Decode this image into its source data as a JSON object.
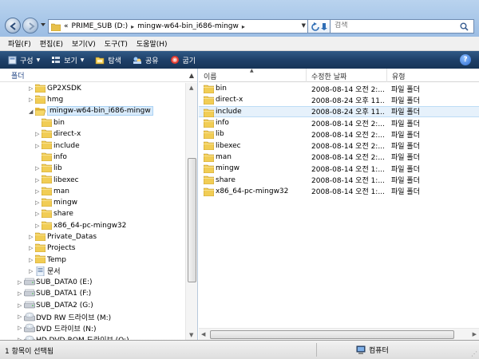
{
  "address": {
    "crumbs_prefix": "«",
    "crumbs": [
      "PRIME_SUB (D:)",
      "mingw-w64-bin_i686-mingw"
    ],
    "search_placeholder": "검색"
  },
  "menu": [
    "파일(F)",
    "편집(E)",
    "보기(V)",
    "도구(T)",
    "도움말(H)"
  ],
  "toolbar": {
    "organize": "구성",
    "views": "보기",
    "explore": "탐색",
    "share": "공유",
    "burn": "굽기",
    "help": "?"
  },
  "left_pane": {
    "header": "폴더",
    "tree": [
      {
        "label": "GP2XSDK",
        "level": 1,
        "type": "folder",
        "expanded": false
      },
      {
        "label": "hmg",
        "level": 1,
        "type": "folder",
        "expanded": false
      },
      {
        "label": "mingw-w64-bin_i686-mingw",
        "level": 1,
        "type": "folder",
        "expanded": true,
        "selected": true
      },
      {
        "label": "bin",
        "level": 2,
        "type": "folder",
        "expanded": null
      },
      {
        "label": "direct-x",
        "level": 2,
        "type": "folder",
        "expanded": false
      },
      {
        "label": "include",
        "level": 2,
        "type": "folder",
        "expanded": false
      },
      {
        "label": "info",
        "level": 2,
        "type": "folder",
        "expanded": null
      },
      {
        "label": "lib",
        "level": 2,
        "type": "folder",
        "expanded": false
      },
      {
        "label": "libexec",
        "level": 2,
        "type": "folder",
        "expanded": false
      },
      {
        "label": "man",
        "level": 2,
        "type": "folder",
        "expanded": false
      },
      {
        "label": "mingw",
        "level": 2,
        "type": "folder",
        "expanded": false
      },
      {
        "label": "share",
        "level": 2,
        "type": "folder",
        "expanded": false
      },
      {
        "label": "x86_64-pc-mingw32",
        "level": 2,
        "type": "folder",
        "expanded": false
      },
      {
        "label": "Private_Datas",
        "level": 1,
        "type": "folder",
        "expanded": false
      },
      {
        "label": "Projects",
        "level": 1,
        "type": "folder",
        "expanded": false
      },
      {
        "label": "Temp",
        "level": 1,
        "type": "folder",
        "expanded": false
      },
      {
        "label": "문서",
        "level": 1,
        "type": "doc",
        "expanded": false
      },
      {
        "label": "SUB_DATA0 (E:)",
        "level": 0,
        "type": "drive",
        "expanded": false
      },
      {
        "label": "SUB_DATA1 (F:)",
        "level": 0,
        "type": "drive",
        "expanded": false
      },
      {
        "label": "SUB_DATA2 (G:)",
        "level": 0,
        "type": "drive",
        "expanded": false
      },
      {
        "label": "DVD RW 드라이브 (M:)",
        "level": 0,
        "type": "dvd",
        "expanded": false
      },
      {
        "label": "DVD 드라이브 (N:)",
        "level": 0,
        "type": "dvd",
        "expanded": false
      },
      {
        "label": "HD DVD-ROM 드라이브 (O:)",
        "level": 0,
        "type": "dvd",
        "expanded": false
      }
    ]
  },
  "columns": {
    "name": "이름",
    "date": "수정한 날짜",
    "type": "유형"
  },
  "files": [
    {
      "name": "bin",
      "date": "2008-08-14 오전 2:...",
      "type": "파일 폴더"
    },
    {
      "name": "direct-x",
      "date": "2008-08-24 오후 11...",
      "type": "파일 폴더"
    },
    {
      "name": "include",
      "date": "2008-08-24 오후 11...",
      "type": "파일 폴더",
      "selected": true
    },
    {
      "name": "info",
      "date": "2008-08-14 오전 2:...",
      "type": "파일 폴더"
    },
    {
      "name": "lib",
      "date": "2008-08-14 오전 2:...",
      "type": "파일 폴더"
    },
    {
      "name": "libexec",
      "date": "2008-08-14 오전 2:...",
      "type": "파일 폴더"
    },
    {
      "name": "man",
      "date": "2008-08-14 오전 2:...",
      "type": "파일 폴더"
    },
    {
      "name": "mingw",
      "date": "2008-08-14 오전 1:...",
      "type": "파일 폴더"
    },
    {
      "name": "share",
      "date": "2008-08-14 오전 1:...",
      "type": "파일 폴더"
    },
    {
      "name": "x86_64-pc-mingw32",
      "date": "2008-08-14 오전 1:...",
      "type": "파일 폴더"
    }
  ],
  "status": {
    "left": "1 항목이 선택됨",
    "right": "컴퓨터"
  }
}
